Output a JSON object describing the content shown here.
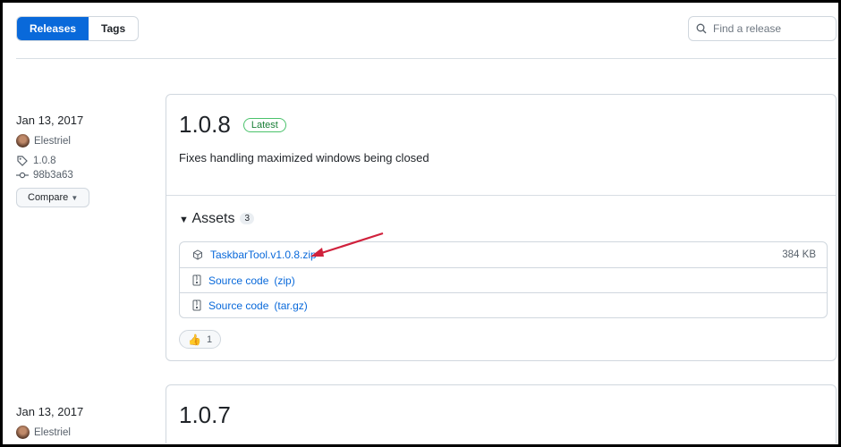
{
  "tabs": {
    "releases": "Releases",
    "tags": "Tags"
  },
  "search": {
    "placeholder": "Find a release"
  },
  "releases": [
    {
      "date": "Jan 13, 2017",
      "author": "Elestriel",
      "tag": "1.0.8",
      "commit": "98b3a63",
      "compare": "Compare",
      "version": "1.0.8",
      "badge": "Latest",
      "notes": "Fixes handling maximized windows being closed",
      "assets_label": "Assets",
      "assets_count": "3",
      "assets": [
        {
          "name": "TaskbarTool.v1.0.8.zip",
          "size": "384 KB"
        },
        {
          "name": "Source code",
          "suffix": "(zip)"
        },
        {
          "name": "Source code",
          "suffix": "(tar.gz)"
        }
      ],
      "reaction_count": "1"
    },
    {
      "date": "Jan 13, 2017",
      "author": "Elestriel",
      "version": "1.0.7"
    }
  ],
  "colors": {
    "accent": "#0969da",
    "arrow": "#d0213c"
  }
}
